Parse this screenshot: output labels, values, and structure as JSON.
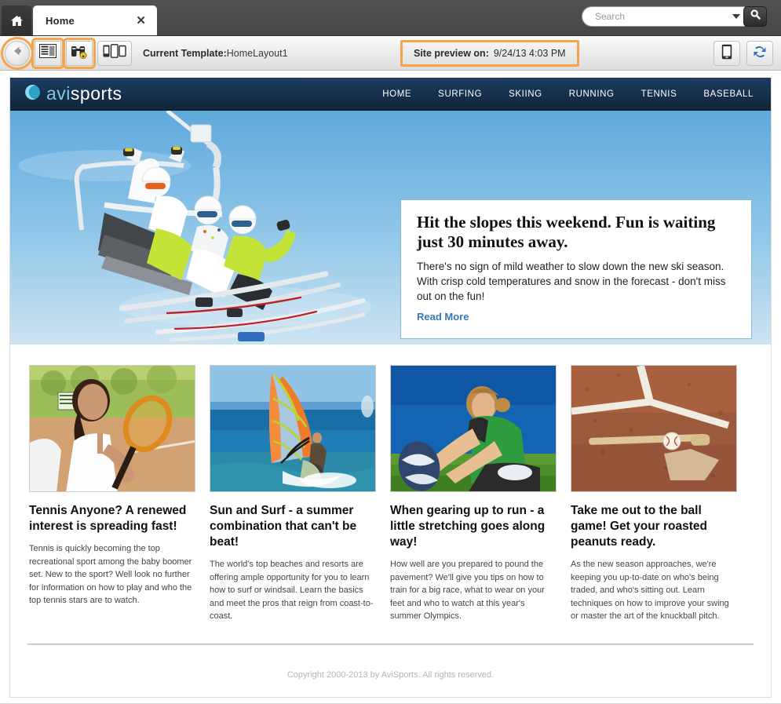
{
  "window": {
    "home_button_icon": "home-icon",
    "tabs": [
      {
        "label": "Home",
        "close_icon": "close-icon"
      }
    ],
    "search": {
      "placeholder": "Search",
      "value": "",
      "dropdown_icon": "chevron-down-icon",
      "submit_icon": "search-icon"
    }
  },
  "toolbar": {
    "back_icon": "back-arrow-icon",
    "layout_icon": "page-layout-icon",
    "binoculars_icon": "binoculars-icon",
    "devices_icon": "multi-device-icon",
    "current_template_label": "Current Template:",
    "current_template_value": "HomeLayout1",
    "site_preview_label": "Site preview on:",
    "site_preview_value": "9/24/13 4:03 PM",
    "mobile_preview_icon": "mobile-device-icon",
    "refresh_icon": "refresh-sync-icon",
    "highlight_color": "#f5a44a"
  },
  "site": {
    "brand": {
      "prefix": "avi",
      "suffix": "sports",
      "mark_icon": "crescent-logo-icon"
    },
    "nav": [
      {
        "label": "HOME"
      },
      {
        "label": "SURFING"
      },
      {
        "label": "SKIING"
      },
      {
        "label": "RUNNING"
      },
      {
        "label": "TENNIS"
      },
      {
        "label": "BASEBALL"
      }
    ],
    "hero": {
      "image_alt": "three-skiers-on-chairlift-photo",
      "headline": "Hit the slopes this weekend. Fun is waiting just 30 minutes away.",
      "body": "There's no sign of mild weather to slow down the new ski season.  With crisp cold temperatures and snow in the forecast - don't miss out on the fun!",
      "read_more": "Read More"
    },
    "cards": [
      {
        "image_alt": "woman-with-tennis-racket-photo",
        "title": "Tennis Anyone? A renewed interest is spreading fast!",
        "body": "Tennis is quickly becoming the top recreational sport among the baby boomer set. New to the sport? Well look no further for information on how to play and who the top tennis stars are to watch."
      },
      {
        "image_alt": "windsurfer-on-ocean-photo",
        "title": "Sun and Surf - a summer combination that can't be beat!",
        "body": "The world's top beaches and resorts are offering ample opportunity for you to learn how to surf or windsail.  Learn the basics and meet the pros that reign from coast-to-coast."
      },
      {
        "image_alt": "woman-stretching-on-grass-photo",
        "title": "When gearing up to run - a little stretching goes along way!",
        "body": "How well are you prepared to pound the pavement? We'll give you tips on how to train for a big race, what to wear on your feet and who to watch at this year's summer Olympics."
      },
      {
        "image_alt": "baseball-bat-on-home-plate-photo",
        "title": "Take me out to the ball game! Get your roasted peanuts ready.",
        "body": "As the new season approaches, we're keeping you up-to-date on who's being traded, and who's sitting out. Learn techniques on how to improve your swing or master the art of the knuckball pitch."
      }
    ],
    "footer": {
      "copyright": "Copyright 2000-2013 by AviSports. All rights reserved."
    }
  },
  "colors": {
    "header_blue": "#17314f",
    "logo_cyan": "#7ec8e3",
    "highlight_orange": "#f5a44a",
    "link_blue": "#3a78b5"
  }
}
